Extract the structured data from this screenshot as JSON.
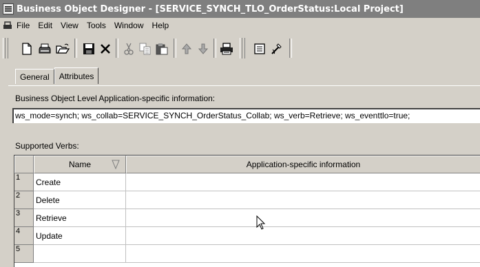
{
  "window": {
    "title": "Business Object Designer - [SERVICE_SYNCH_TLO_OrderStatus:Local Project]"
  },
  "menu": [
    "File",
    "Edit",
    "View",
    "Tools",
    "Window",
    "Help"
  ],
  "toolbar": {
    "buttons": [
      "new-icon",
      "open-icon",
      "open-folder-icon",
      "save-icon",
      "delete-icon",
      "cut-icon",
      "copy-icon",
      "paste-icon",
      "move-up-icon",
      "move-down-icon",
      "print-icon",
      "properties-icon",
      "wand-icon"
    ]
  },
  "tabs": [
    {
      "label": "General",
      "active": false
    },
    {
      "label": "Attributes",
      "active": true
    }
  ],
  "bo_asi": {
    "label": "Business Object Level Application-specific information:",
    "value": "ws_mode=synch; ws_collab=SERVICE_SYNCH_OrderStatus_Collab; ws_verb=Retrieve; ws_eventtlo=true;"
  },
  "verbs": {
    "label": "Supported Verbs:",
    "columns": [
      "Name",
      "Application-specific information"
    ],
    "rows": [
      {
        "num": "1",
        "name": "Create",
        "asi": ""
      },
      {
        "num": "2",
        "name": "Delete",
        "asi": ""
      },
      {
        "num": "3",
        "name": "Retrieve",
        "asi": ""
      },
      {
        "num": "4",
        "name": "Update",
        "asi": ""
      },
      {
        "num": "5",
        "name": "",
        "asi": ""
      }
    ]
  }
}
